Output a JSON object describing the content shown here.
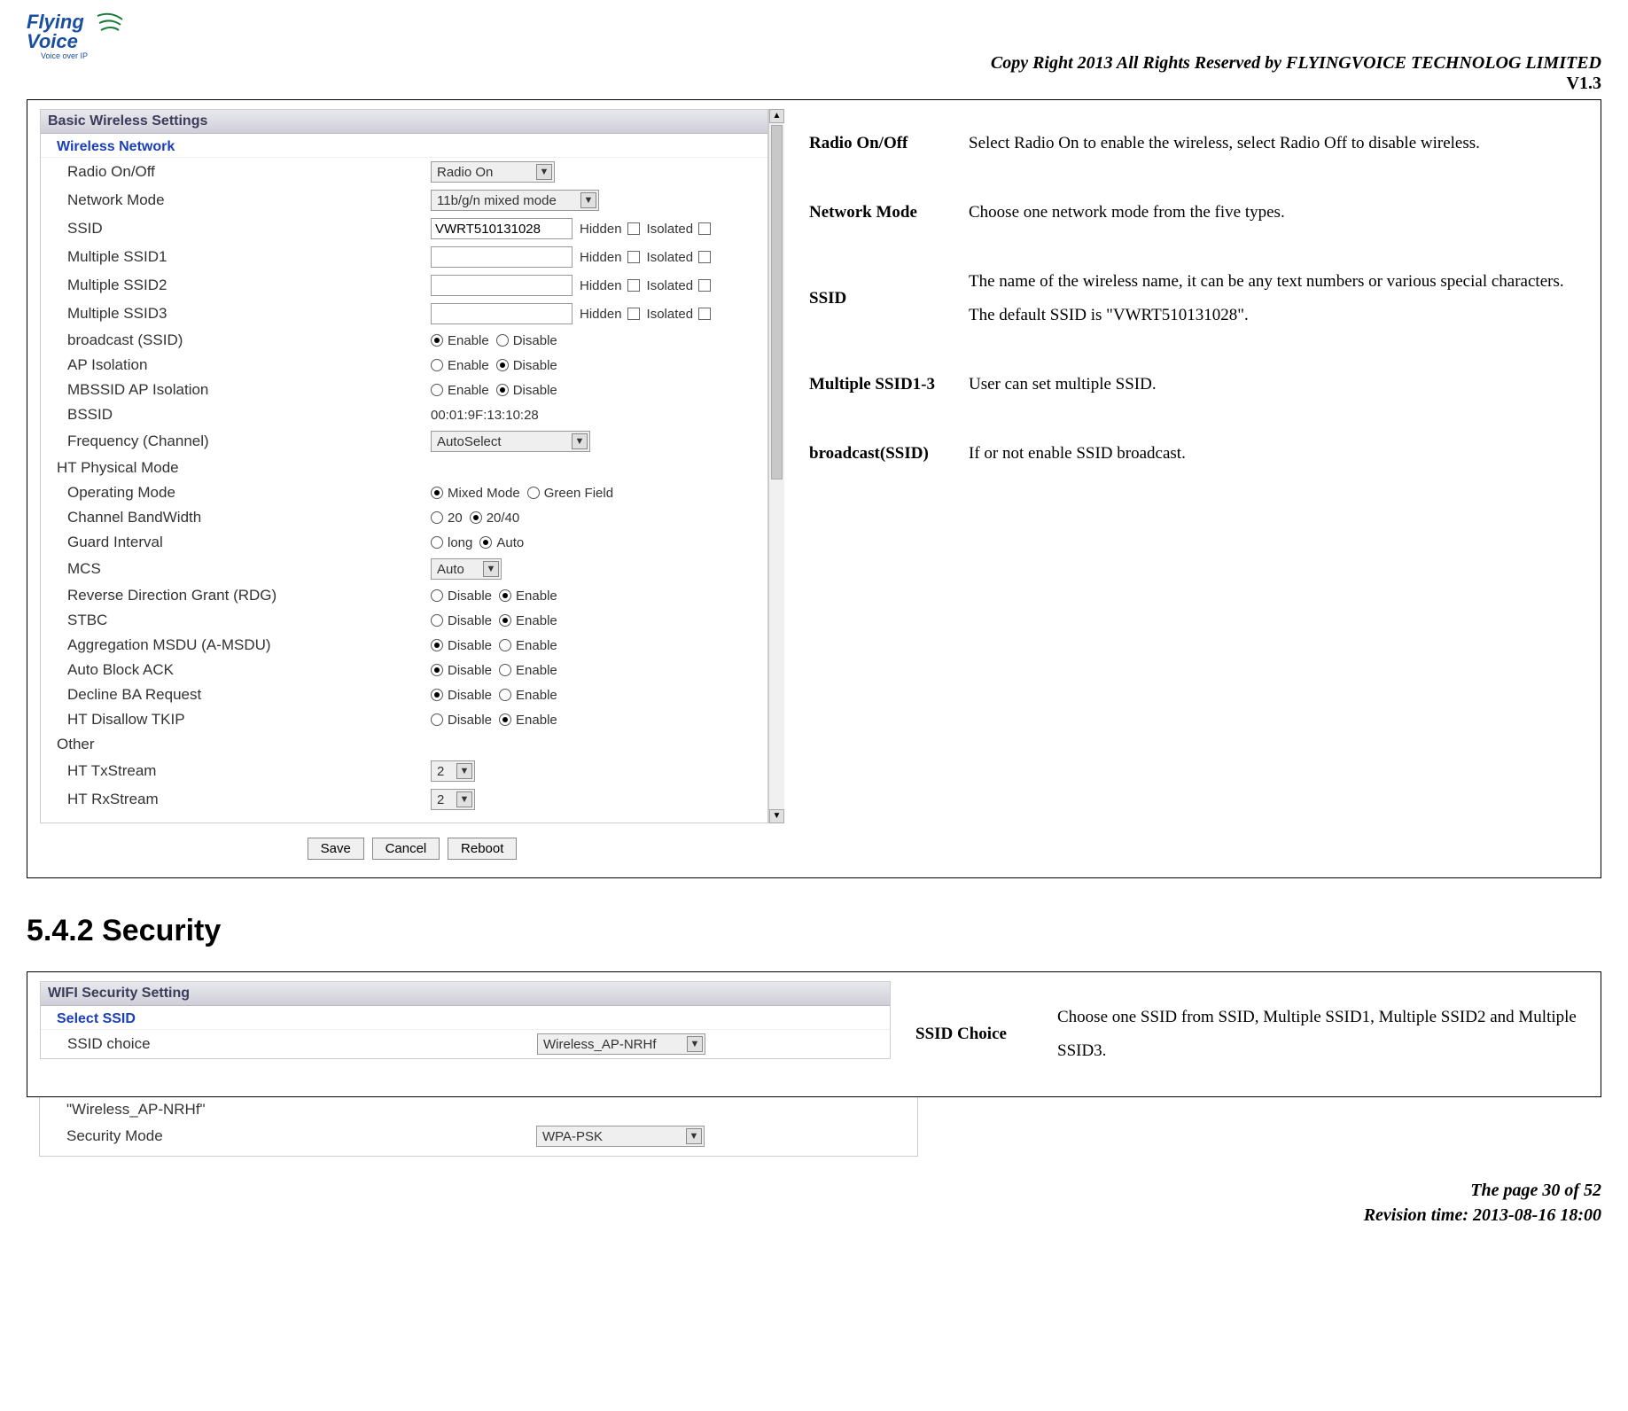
{
  "header": {
    "logo_top": "Flying",
    "logo_bottom": "Voice",
    "logo_tag": "Voice over IP",
    "copyright": "Copy Right 2013 All Rights Reserved by FLYINGVOICE TECHNOLOG LIMITED",
    "version": "V1.3"
  },
  "panel1": {
    "title": "Basic Wireless Settings",
    "subtitle": "Wireless Network",
    "rows": {
      "radio_label": "Radio On/Off",
      "radio_select": "Radio On",
      "netmode_label": "Network Mode",
      "netmode_select": "11b/g/n mixed mode",
      "ssid_label": "SSID",
      "ssid_value": "VWRT510131028",
      "hidden_label": "Hidden",
      "isolated_label": "Isolated",
      "mssid1_label": "Multiple SSID1",
      "mssid2_label": "Multiple SSID2",
      "mssid3_label": "Multiple SSID3",
      "broadcast_label": "broadcast (SSID)",
      "apiso_label": "AP Isolation",
      "mbssid_label": "MBSSID AP Isolation",
      "bssid_label": "BSSID",
      "bssid_value": "00:01:9F:13:10:28",
      "freq_label": "Frequency (Channel)",
      "freq_select": "AutoSelect",
      "enable": "Enable",
      "disable": "Disable"
    },
    "ht": {
      "header": "HT Physical Mode",
      "opmode_label": "Operating Mode",
      "mixed": "Mixed Mode",
      "green": "Green Field",
      "bw_label": "Channel BandWidth",
      "bw20": "20",
      "bw40": "20/40",
      "gi_label": "Guard Interval",
      "gi_long": "long",
      "gi_auto": "Auto",
      "mcs_label": "MCS",
      "mcs_select": "Auto",
      "rdg_label": "Reverse Direction Grant (RDG)",
      "stbc_label": "STBC",
      "amsdu_label": "Aggregation MSDU (A-MSDU)",
      "aback_label": "Auto Block ACK",
      "dba_label": "Decline BA Request",
      "tkip_label": "HT Disallow TKIP",
      "other_label": "Other",
      "httx_label": "HT TxStream",
      "htrx_label": "HT RxStream",
      "stream2": "2"
    },
    "buttons": {
      "save": "Save",
      "cancel": "Cancel",
      "reboot": "Reboot"
    }
  },
  "desc1": [
    {
      "term": "Radio On/Off",
      "desc": "Select Radio On to enable the wireless, select Radio Off to disable wireless."
    },
    {
      "term": "Network Mode",
      "desc": "Choose one network mode from the five types."
    },
    {
      "term": "SSID",
      "desc": "The name of the wireless name, it can be any text numbers or various special characters. The default SSID is \"VWRT510131028\"."
    },
    {
      "term": "Multiple SSID1-3",
      "desc": "User can set multiple SSID."
    },
    {
      "term": "broadcast(SSID)",
      "desc": "If or not enable SSID broadcast."
    }
  ],
  "section_heading": "5.4.2 Security",
  "panel2": {
    "title": "WIFI Security Setting",
    "subtitle": "Select SSID",
    "ssid_choice_label": "SSID choice",
    "ssid_choice_select": "Wireless_AP-NRHf",
    "ssidq_label": "\"Wireless_AP-NRHf\"",
    "secmode_label": "Security Mode",
    "secmode_select": "WPA-PSK"
  },
  "desc2": [
    {
      "term": "SSID Choice",
      "desc": "Choose one SSID from SSID, Multiple SSID1, Multiple SSID2 and Multiple SSID3."
    }
  ],
  "footer": {
    "page": "The page 30 of 52",
    "revision": "Revision time: 2013-08-16 18:00"
  }
}
